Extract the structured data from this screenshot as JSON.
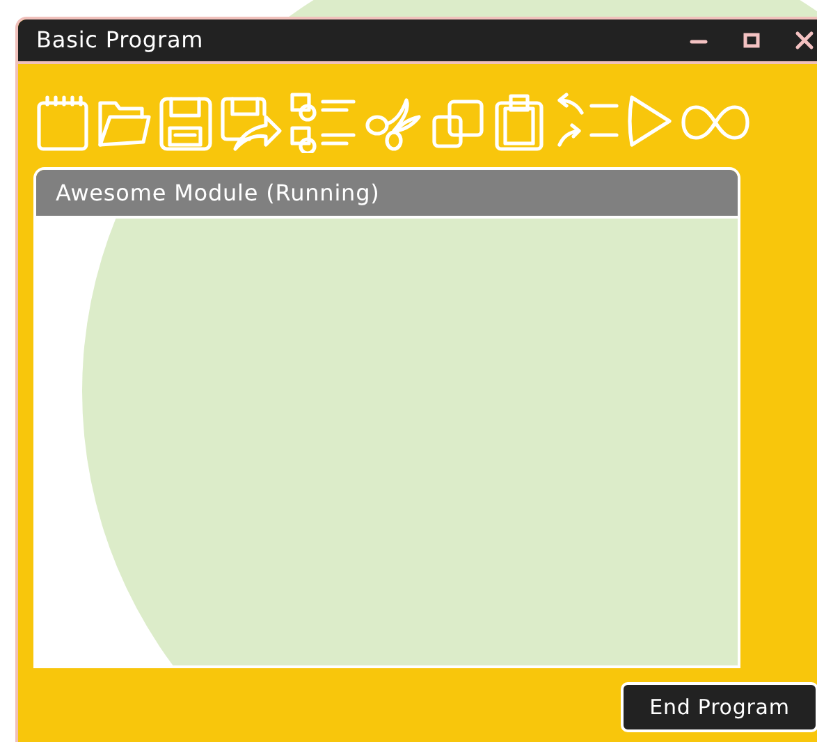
{
  "window": {
    "title": "Basic Program"
  },
  "module": {
    "title": "Awesome Module (Running)"
  },
  "buttons": [
    {
      "label": "End Program"
    }
  ]
}
